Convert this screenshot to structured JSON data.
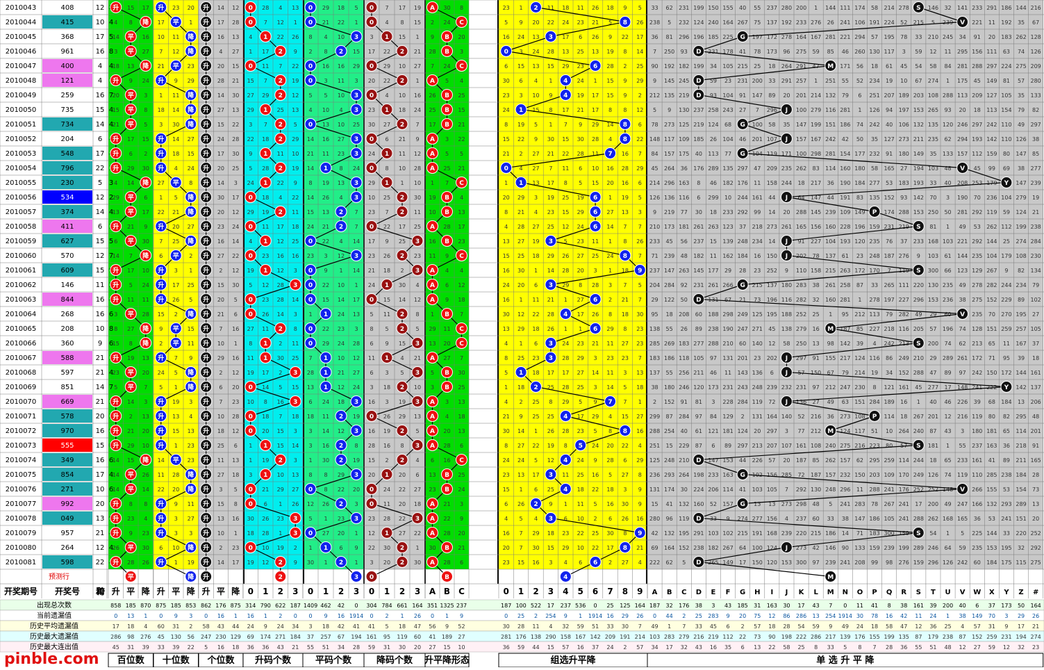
{
  "chart_data": {
    "type": "table",
    "rows": [
      {
        "period": "2010043",
        "number": "408",
        "sum": "12",
        "span": "8",
        "hl": ""
      },
      {
        "period": "2010044",
        "number": "415",
        "sum": "10",
        "span": "4",
        "hl": "teal"
      },
      {
        "period": "2010045",
        "number": "368",
        "sum": "17",
        "span": "5",
        "hl": ""
      },
      {
        "period": "2010046",
        "number": "961",
        "sum": "16",
        "span": "8",
        "hl": ""
      },
      {
        "period": "2010047",
        "number": "400",
        "sum": "4",
        "span": "4",
        "hl": "pink"
      },
      {
        "period": "2010048",
        "number": "121",
        "sum": "4",
        "span": "1",
        "hl": "pink"
      },
      {
        "period": "2010049",
        "number": "259",
        "sum": "16",
        "span": "7",
        "hl": ""
      },
      {
        "period": "2010050",
        "number": "735",
        "sum": "15",
        "span": "4",
        "hl": ""
      },
      {
        "period": "2010051",
        "number": "734",
        "sum": "14",
        "span": "4",
        "hl": "teal"
      },
      {
        "period": "2010052",
        "number": "204",
        "sum": "6",
        "span": "4",
        "hl": ""
      },
      {
        "period": "2010053",
        "number": "548",
        "sum": "17",
        "span": "4",
        "hl": "teal"
      },
      {
        "period": "2010054",
        "number": "796",
        "sum": "22",
        "span": "3",
        "hl": "teal"
      },
      {
        "period": "2010055",
        "number": "230",
        "sum": "5",
        "span": "3",
        "hl": "teal"
      },
      {
        "period": "2010056",
        "number": "534",
        "sum": "12",
        "span": "2",
        "hl": "blue"
      },
      {
        "period": "2010057",
        "number": "374",
        "sum": "14",
        "span": "4",
        "hl": "teal"
      },
      {
        "period": "2010058",
        "number": "411",
        "sum": "6",
        "span": "3",
        "hl": "pink"
      },
      {
        "period": "2010059",
        "number": "627",
        "sum": "15",
        "span": "5",
        "hl": "teal"
      },
      {
        "period": "2010060",
        "number": "570",
        "sum": "12",
        "span": "7",
        "hl": ""
      },
      {
        "period": "2010061",
        "number": "609",
        "sum": "15",
        "span": "9",
        "hl": "teal"
      },
      {
        "period": "2010062",
        "number": "146",
        "sum": "11",
        "span": "5",
        "hl": ""
      },
      {
        "period": "2010063",
        "number": "844",
        "sum": "16",
        "span": "4",
        "hl": "pink"
      },
      {
        "period": "2010064",
        "number": "268",
        "sum": "16",
        "span": "6",
        "hl": ""
      },
      {
        "period": "2010065",
        "number": "208",
        "sum": "10",
        "span": "8",
        "hl": ""
      },
      {
        "period": "2010066",
        "number": "360",
        "sum": "9",
        "span": "6",
        "hl": ""
      },
      {
        "period": "2010067",
        "number": "588",
        "sum": "21",
        "span": "3",
        "hl": "pink"
      },
      {
        "period": "2010068",
        "number": "597",
        "sum": "21",
        "span": "4",
        "hl": ""
      },
      {
        "period": "2010069",
        "number": "851",
        "sum": "14",
        "span": "7",
        "hl": ""
      },
      {
        "period": "2010070",
        "number": "669",
        "sum": "21",
        "span": "3",
        "hl": "pink"
      },
      {
        "period": "2010071",
        "number": "578",
        "sum": "20",
        "span": "3",
        "hl": "teal"
      },
      {
        "period": "2010072",
        "number": "970",
        "sum": "16",
        "span": "9",
        "hl": "teal"
      },
      {
        "period": "2010073",
        "number": "555",
        "sum": "15",
        "span": "0",
        "hl": "red"
      },
      {
        "period": "2010074",
        "number": "349",
        "sum": "16",
        "span": "6",
        "hl": "teal"
      },
      {
        "period": "2010075",
        "number": "854",
        "sum": "17",
        "span": "4",
        "hl": "teal"
      },
      {
        "period": "2010076",
        "number": "271",
        "sum": "10",
        "span": "6",
        "hl": "teal"
      },
      {
        "period": "2010077",
        "number": "992",
        "sum": "20",
        "span": "7",
        "hl": "pink"
      },
      {
        "period": "2010078",
        "number": "049",
        "sum": "13",
        "span": "9",
        "hl": "teal"
      },
      {
        "period": "2010079",
        "number": "957",
        "sum": "21",
        "span": "4",
        "hl": ""
      },
      {
        "period": "2010080",
        "number": "264",
        "sum": "12",
        "span": "4",
        "hl": ""
      },
      {
        "period": "2010081",
        "number": "598",
        "sum": "22",
        "span": "4",
        "hl": "teal"
      }
    ],
    "forecast_label": "预测行",
    "header_left": [
      "开奖期号",
      "开奖号",
      "和",
      "跨"
    ],
    "sections": [
      {
        "id": "hundreds",
        "title": "百位数",
        "cols": [
          "升",
          "平",
          "降"
        ]
      },
      {
        "id": "tens",
        "title": "十位数",
        "cols": [
          "升",
          "平",
          "降"
        ]
      },
      {
        "id": "units",
        "title": "个位数",
        "cols": [
          "升",
          "平",
          "降"
        ]
      },
      {
        "id": "upcount",
        "title": "升码个数",
        "cols": [
          "0",
          "1",
          "2",
          "3"
        ]
      },
      {
        "id": "flatcount",
        "title": "平码个数",
        "cols": [
          "0",
          "1",
          "2",
          "3"
        ]
      },
      {
        "id": "downcount",
        "title": "降码个数",
        "cols": [
          "0",
          "1",
          "2",
          "3"
        ]
      },
      {
        "id": "shape",
        "title": "升平降形态",
        "cols": [
          "A",
          "B",
          "C"
        ]
      },
      {
        "id": "group",
        "title": "组选升平降",
        "cols": [
          "0",
          "1",
          "2",
          "3",
          "4",
          "5",
          "6",
          "7",
          "8",
          "9"
        ]
      },
      {
        "id": "single",
        "title": "单 选 升 平 降",
        "cols": [
          "A",
          "B",
          "C",
          "D",
          "E",
          "F",
          "G",
          "H",
          "I",
          "J",
          "K",
          "L",
          "M",
          "N",
          "O",
          "P",
          "Q",
          "R",
          "S",
          "T",
          "U",
          "V",
          "W",
          "X",
          "Y",
          "Z",
          "#"
        ]
      }
    ],
    "stat_labels": [
      "出现总次数",
      "当前遗漏值",
      "历史平均遗漏值",
      "历史最大遗漏值",
      "历史最大连出值"
    ],
    "stats_occurrences": [
      "858",
      "185",
      "870",
      "875",
      "185",
      "853",
      "862",
      "176",
      "875",
      "314",
      "790",
      "622",
      "187",
      "1409",
      "462",
      "42",
      "0",
      "304",
      "784",
      "661",
      "164",
      "351",
      "1325",
      "237",
      "187",
      "100",
      "522",
      "17",
      "237",
      "536",
      "0",
      "25",
      "125",
      "164",
      "187",
      "32",
      "176",
      "38",
      "3",
      "43",
      "185",
      "31",
      "163",
      "30",
      "17",
      "43",
      "7",
      "0",
      "11",
      "41",
      "8",
      "38",
      "161",
      "39",
      "200",
      "40",
      "6",
      "37",
      "173",
      "50",
      "164"
    ],
    "stats_current": [
      "0",
      "13",
      "1",
      "0",
      "9",
      "3",
      "0",
      "16",
      "1",
      "16",
      "1",
      "2",
      "0",
      "0",
      "9",
      "16",
      "1914",
      "0",
      "2",
      "1",
      "26",
      "0",
      "1",
      "9",
      "0",
      "25",
      "2",
      "254",
      "9",
      "1",
      "1914",
      "16",
      "29",
      "26",
      "0",
      "44",
      "2",
      "25",
      "283",
      "9",
      "20",
      "75",
      "12",
      "86",
      "286",
      "13",
      "254",
      "1914",
      "30",
      "78",
      "16",
      "42",
      "11",
      "24",
      "1",
      "38",
      "149",
      "70",
      "3",
      "29",
      "26"
    ],
    "watermark": "pinble.com"
  },
  "colors": {
    "green": "#00dd00",
    "yellow": "#ffff00",
    "cyan": "#00eeee",
    "mint": "#22ee88",
    "gray": "#c8c8c8",
    "ball_red": "#ee1111",
    "ball_blue": "#1122ee",
    "ball_darkred": "#991111",
    "ball_black": "#111111",
    "teal": "#22a8b0",
    "pink": "#ee77ee",
    "blue": "#0000ff",
    "red": "#ff0000"
  }
}
